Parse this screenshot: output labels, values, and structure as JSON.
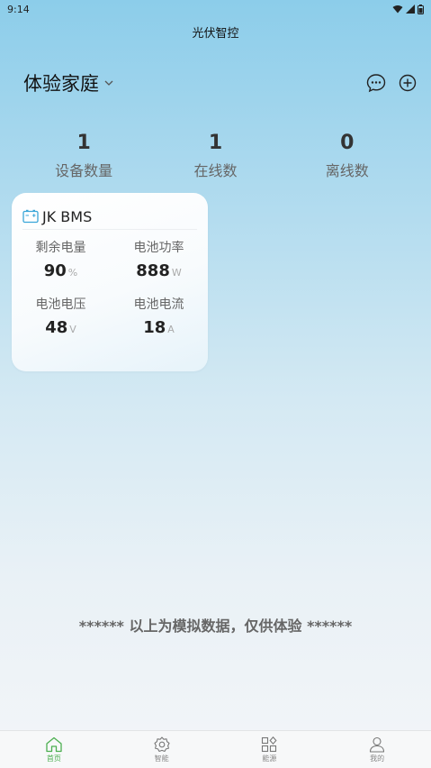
{
  "status_bar": {
    "time": "9:14"
  },
  "app": {
    "title": "光伏智控"
  },
  "family": {
    "name": "体验家庭"
  },
  "stats": [
    {
      "value": "1",
      "label": "设备数量"
    },
    {
      "value": "1",
      "label": "在线数"
    },
    {
      "value": "0",
      "label": "离线数"
    }
  ],
  "device": {
    "name": "JK BMS",
    "metrics": [
      {
        "label": "剩余电量",
        "value": "90",
        "unit": "%"
      },
      {
        "label": "电池功率",
        "value": "888",
        "unit": "W"
      },
      {
        "label": "电池电压",
        "value": "48",
        "unit": "V"
      },
      {
        "label": "电池电流",
        "value": "18",
        "unit": "A"
      }
    ]
  },
  "note": "****** 以上为模拟数据，仅供体验 ******",
  "tabs": [
    {
      "label": "首页",
      "icon": "home-icon",
      "active": true
    },
    {
      "label": "智能",
      "icon": "gear-icon",
      "active": false
    },
    {
      "label": "能源",
      "icon": "grid-icon",
      "active": false
    },
    {
      "label": "我的",
      "icon": "user-icon",
      "active": false
    }
  ],
  "colors": {
    "accent": "#4caf50",
    "card_icon": "#3aa6d8"
  }
}
